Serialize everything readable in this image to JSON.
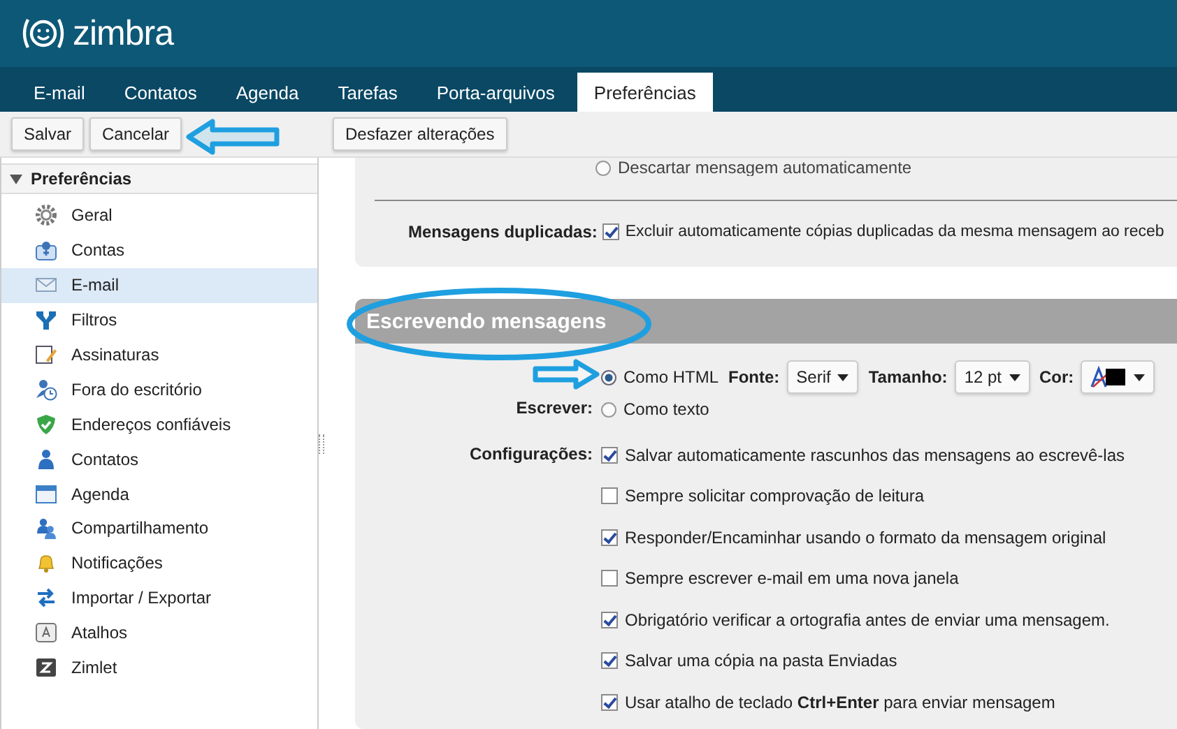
{
  "app": {
    "logo": "zimbra"
  },
  "tabs": [
    {
      "label": "E-mail",
      "selected": false
    },
    {
      "label": "Contatos",
      "selected": false
    },
    {
      "label": "Agenda",
      "selected": false
    },
    {
      "label": "Tarefas",
      "selected": false
    },
    {
      "label": "Porta-arquivos",
      "selected": false
    },
    {
      "label": "Preferências",
      "selected": true
    }
  ],
  "toolbar": {
    "left_buttons": [
      "Salvar",
      "Cancelar"
    ],
    "right_buttons": [
      "Desfazer alterações"
    ]
  },
  "sidebar": {
    "header": "Preferências",
    "expanded": true,
    "items": [
      {
        "label": "Geral",
        "selected": false
      },
      {
        "label": "Contas",
        "selected": false
      },
      {
        "label": "E-mail",
        "selected": true
      },
      {
        "label": "Filtros",
        "selected": false
      },
      {
        "label": "Assinaturas",
        "selected": false
      },
      {
        "label": "Fora do escritório",
        "selected": false
      },
      {
        "label": "Endereços confiáveis",
        "selected": false
      },
      {
        "label": "Contatos",
        "selected": false
      },
      {
        "label": "Agenda",
        "selected": false
      },
      {
        "label": "Compartilhamento",
        "selected": false
      },
      {
        "label": "Notificações",
        "selected": false
      },
      {
        "label": "Importar / Exportar",
        "selected": false
      },
      {
        "label": "Atalhos",
        "selected": false
      },
      {
        "label": "Zimlet",
        "selected": false
      }
    ]
  },
  "duplicates_section": {
    "cut_option": {
      "label": "Descartar mensagem automaticamente",
      "selected": false
    },
    "label": "Mensagens duplicadas:",
    "option": {
      "text": "Excluir automaticamente cópias duplicadas da mesma mensagem ao receb",
      "checked": true
    }
  },
  "compose_section": {
    "title": "Escrevendo mensagens",
    "write_label": "Escrever:",
    "formats": [
      {
        "label": "Como HTML",
        "selected": true
      },
      {
        "label": "Como texto",
        "selected": false
      }
    ],
    "font_label": "Fonte:",
    "font_value": "Serif",
    "size_label": "Tamanho:",
    "size_value": "12 pt",
    "color_label": "Cor:",
    "settings_label": "Configurações:",
    "settings": [
      {
        "text": "Salvar automaticamente rascunhos das mensagens ao escrevê-las",
        "checked": true
      },
      {
        "text": "Sempre solicitar comprovação de leitura",
        "checked": false
      },
      {
        "text": "Responder/Encaminhar usando o formato da mensagem original",
        "checked": true
      },
      {
        "text": "Sempre escrever e-mail em uma nova janela",
        "checked": false
      },
      {
        "text": "Obrigatório verificar a ortografia antes de enviar uma mensagem.",
        "checked": true
      },
      {
        "text": "Salvar uma cópia na pasta Enviadas",
        "checked": true
      },
      {
        "text": "Usar atalho de teclado **Ctrl+Enter** para enviar mensagem",
        "checked": true
      }
    ]
  }
}
